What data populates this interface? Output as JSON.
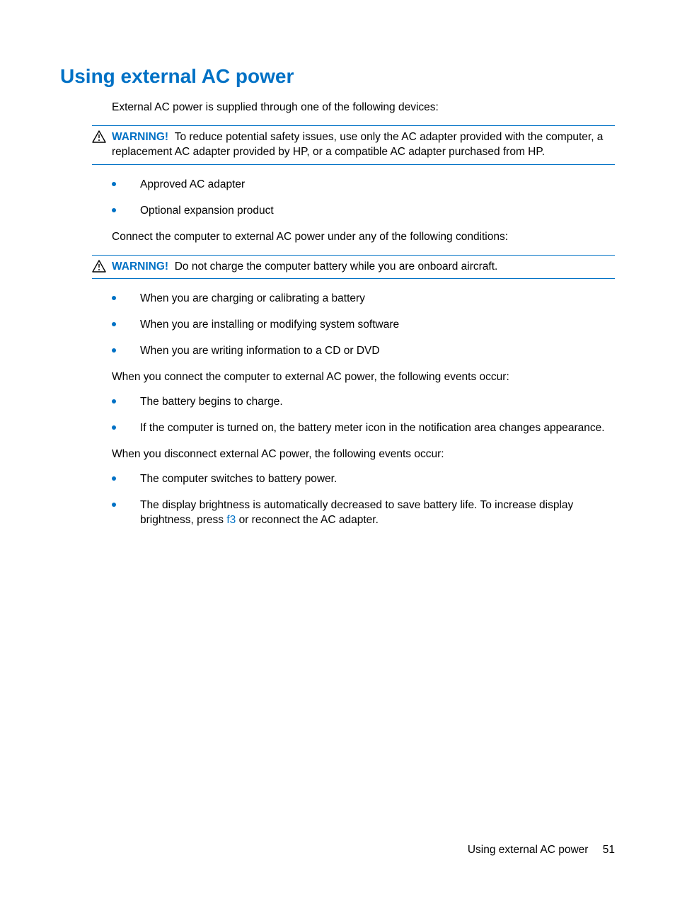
{
  "heading": "Using external AC power",
  "intro": "External AC power is supplied through one of the following devices:",
  "warning1": {
    "label": "WARNING!",
    "text": "To reduce potential safety issues, use only the AC adapter provided with the computer, a replacement AC adapter provided by HP, or a compatible AC adapter purchased from HP."
  },
  "list1": [
    "Approved AC adapter",
    "Optional expansion product"
  ],
  "para2": "Connect the computer to external AC power under any of the following conditions:",
  "warning2": {
    "label": "WARNING!",
    "text": "Do not charge the computer battery while you are onboard aircraft."
  },
  "list2": [
    "When you are charging or calibrating a battery",
    "When you are installing or modifying system software",
    "When you are writing information to a CD or DVD"
  ],
  "para3": "When you connect the computer to external AC power, the following events occur:",
  "list3": [
    "The battery begins to charge.",
    "If the computer is turned on, the battery meter icon in the notification area changes appearance."
  ],
  "para4": "When you disconnect external AC power, the following events occur:",
  "list4_item1": "The computer switches to battery power.",
  "list4_item2_pre": "The display brightness is automatically decreased to save battery life. To increase display brightness, press ",
  "list4_item2_key": "f3",
  "list4_item2_post": " or reconnect the AC adapter.",
  "footer": {
    "title": "Using external AC power",
    "page": "51"
  }
}
